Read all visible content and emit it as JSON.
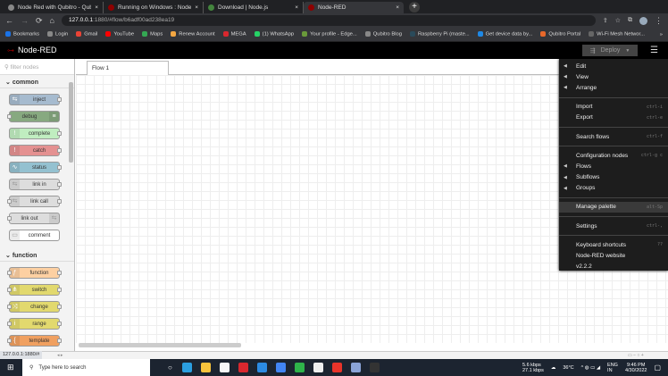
{
  "browser": {
    "tabs": [
      {
        "title": "Node Red with Qubitro - Qubitro",
        "color": "#888888"
      },
      {
        "title": "Running on Windows : Node-RED",
        "color": "#8f0000"
      },
      {
        "title": "Download | Node.js",
        "color": "#43853d"
      },
      {
        "title": "Node-RED",
        "color": "#8f0000",
        "active": true
      }
    ],
    "new_tab": "+",
    "url_host": "127.0.0.1",
    "url_rest": ":1880/#flow/b6adf00ad238ea19",
    "bookmarks": [
      {
        "label": "Bookmarks",
        "color": "#1a73e8"
      },
      {
        "label": "Login",
        "color": "#888"
      },
      {
        "label": "Gmail",
        "color": "#ea4335"
      },
      {
        "label": "YouTube",
        "color": "#ff0000"
      },
      {
        "label": "Maps",
        "color": "#34a853"
      },
      {
        "label": "Renew Account",
        "color": "#f4a742"
      },
      {
        "label": "MEGA",
        "color": "#d9272e"
      },
      {
        "label": "(1) WhatsApp",
        "color": "#25d366"
      },
      {
        "label": "Your profile - Edge...",
        "color": "#6a9a3a"
      },
      {
        "label": "Qubitro Blog",
        "color": "#888"
      },
      {
        "label": "Raspberry Pi (maste...",
        "color": "#2a4a5a"
      },
      {
        "label": "Get device data by...",
        "color": "#1e88e5"
      },
      {
        "label": "Qubitro Portal",
        "color": "#e8682a"
      },
      {
        "label": "Wi-Fi Mesh Networ...",
        "color": "#666"
      }
    ],
    "bookmarks_more": "»",
    "status_url": "127.0.0.1:1880/#"
  },
  "app": {
    "title": "Node-RED",
    "deploy": "Deploy",
    "filter_placeholder": "filter nodes",
    "flow_tab": "Flow 1",
    "categories": [
      {
        "name": "common",
        "nodes": [
          {
            "label": "inject",
            "color": "#a6bbcf",
            "icon": "⇆"
          },
          {
            "label": "debug",
            "color": "#87a980",
            "icon": "≡",
            "right": true
          },
          {
            "label": "complete",
            "color": "#c0edc0",
            "icon": "!"
          },
          {
            "label": "catch",
            "color": "#e49191",
            "icon": "!"
          },
          {
            "label": "status",
            "color": "#94c1d0",
            "icon": "∿"
          },
          {
            "label": "link in",
            "color": "#dddddd",
            "icon": "⇆"
          },
          {
            "label": "link call",
            "color": "#dddddd",
            "icon": "⇆"
          },
          {
            "label": "link out",
            "color": "#dddddd",
            "icon": "⇆",
            "right": true
          },
          {
            "label": "comment",
            "color": "#ffffff",
            "icon": "▭"
          }
        ]
      },
      {
        "name": "function",
        "nodes": [
          {
            "label": "function",
            "color": "#fdd0a2",
            "icon": "ƒ"
          },
          {
            "label": "switch",
            "color": "#e2d96e",
            "icon": "⋔"
          },
          {
            "label": "change",
            "color": "#e2d96e",
            "icon": "⤨"
          },
          {
            "label": "range",
            "color": "#e2d96e",
            "icon": "i"
          },
          {
            "label": "template",
            "color": "#f0a060",
            "icon": "{"
          }
        ]
      }
    ]
  },
  "menu": {
    "groups": [
      [
        {
          "label": "Edit",
          "sub": true
        },
        {
          "label": "View",
          "sub": true
        },
        {
          "label": "Arrange",
          "sub": true
        }
      ],
      [
        {
          "label": "Import",
          "key": "ctrl-i"
        },
        {
          "label": "Export",
          "key": "ctrl-e"
        }
      ],
      [
        {
          "label": "Search flows",
          "key": "ctrl-f"
        }
      ],
      [
        {
          "label": "Configuration nodes",
          "key": "ctrl-g c"
        },
        {
          "label": "Flows",
          "sub": true
        },
        {
          "label": "Subflows",
          "sub": true
        },
        {
          "label": "Groups",
          "sub": true
        }
      ],
      [
        {
          "label": "Manage palette",
          "key": "alt-Sp",
          "highlight": true
        }
      ],
      [
        {
          "label": "Settings",
          "key": "ctrl-,"
        }
      ],
      [
        {
          "label": "Keyboard shortcuts",
          "key": "??"
        },
        {
          "label": "Node-RED website"
        },
        {
          "label": "v2.2.2"
        }
      ]
    ]
  },
  "taskbar": {
    "search": "Type here to search",
    "net_down": "5.6 kbps",
    "net_up": "27.1 kbps",
    "temp": "36°C",
    "lang": "ENG",
    "region": "IN",
    "time": "9:46 PM",
    "date": "4/30/2022",
    "apps": [
      "#2b9fe0",
      "#f7c33c",
      "#f7f7f7",
      "#d9272e",
      "#2c8be3",
      "#4285f4",
      "#2fb34a",
      "#eeeeee",
      "#e8342a",
      "#8aa4d8",
      "#333333"
    ]
  }
}
